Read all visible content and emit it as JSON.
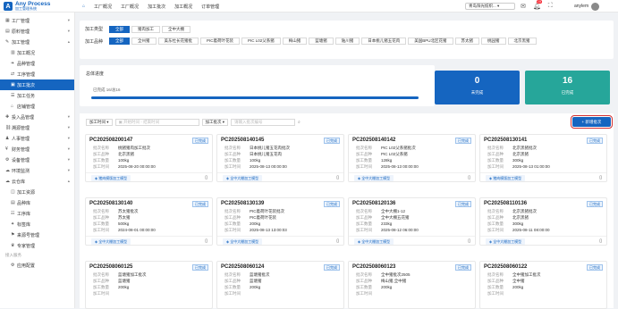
{
  "header": {
    "brand": "Any Process",
    "brand_sub": "加工管理系统",
    "nav": [
      "工厂概况",
      "工厂概况",
      "加工批次",
      "加工概况",
      "订单管理"
    ],
    "factory_select": "青岛阳光纺织...",
    "notif_count": "19",
    "user": "anylem"
  },
  "sidebar": [
    {
      "label": "工厂管理",
      "icon": "factory-icon",
      "kind": "top",
      "caret": "▾"
    },
    {
      "label": "原料管理",
      "icon": "box-icon",
      "kind": "top",
      "caret": "▾"
    },
    {
      "label": "加工管理",
      "icon": "tool-icon",
      "kind": "top",
      "caret": "▴"
    },
    {
      "label": "加工概况",
      "icon": "chart-icon",
      "kind": "sub"
    },
    {
      "label": "品种管理",
      "icon": "leaf-icon",
      "kind": "sub"
    },
    {
      "label": "工序管理",
      "icon": "process-icon",
      "kind": "sub"
    },
    {
      "label": "加工批次",
      "icon": "batch-icon",
      "kind": "sub",
      "active": true
    },
    {
      "label": "加工任务",
      "icon": "task-icon",
      "kind": "sub"
    },
    {
      "label": "店铺管理",
      "icon": "shop-icon",
      "kind": "sub"
    },
    {
      "label": "投入品管理",
      "icon": "input-icon",
      "kind": "top",
      "caret": "▾"
    },
    {
      "label": "溯源管理",
      "icon": "trace-icon",
      "kind": "top",
      "caret": "▾"
    },
    {
      "label": "人事管理",
      "icon": "person-icon",
      "kind": "top",
      "caret": "▾"
    },
    {
      "label": "财务管理",
      "icon": "money-icon",
      "kind": "top",
      "caret": "▾"
    },
    {
      "label": "设备管理",
      "icon": "device-icon",
      "kind": "top",
      "caret": "▾"
    },
    {
      "label": "环境监测",
      "icon": "env-icon",
      "kind": "top",
      "caret": "▾"
    },
    {
      "label": "云仓库",
      "icon": "cloud-icon",
      "kind": "top",
      "caret": "▴"
    },
    {
      "label": "加工资源",
      "icon": "resource-icon",
      "kind": "sub"
    },
    {
      "label": "品种库",
      "icon": "library-icon",
      "kind": "sub"
    },
    {
      "label": "工序库",
      "icon": "procedure-icon",
      "kind": "sub"
    },
    {
      "label": "标签库",
      "icon": "tag-icon",
      "kind": "sub"
    },
    {
      "label": "来源号管理",
      "icon": "source-icon",
      "kind": "sub"
    },
    {
      "label": "专家管理",
      "icon": "expert-icon",
      "kind": "sub"
    },
    {
      "label": "接入服务",
      "icon": "",
      "kind": "grp"
    },
    {
      "label": "应用配置",
      "icon": "config-icon",
      "kind": "sub"
    }
  ],
  "filters": {
    "type_label": "加工类型",
    "types": [
      "全部",
      "猪肉加工",
      "全中大棚"
    ],
    "variety_label": "加工品种",
    "varieties": [
      "全部",
      "全州猪",
      "美东杜长花猪批",
      "PIC着荷叶花装",
      "PIC L02父系猪",
      "梅山猪",
      "蓝塘猪",
      "陆川猪",
      "日本桃儿猪五花肉",
      "美国BPU北区花猪",
      "苏太猪",
      "桃园猪",
      "北京黑猪"
    ]
  },
  "progress": {
    "title": "总体进度",
    "text": "已完成 16/总16",
    "value": 1.0
  },
  "stats": [
    {
      "value": "0",
      "label": "未完成",
      "color": "#1565c0"
    },
    {
      "value": "16",
      "label": "已完成",
      "color": "#26a69a"
    }
  ],
  "toolbar": {
    "time_select": "加工时间",
    "start_ph": "开始时间",
    "sep": "-",
    "end_ph": "结束时间",
    "batch_select": "加工批次",
    "search_ph": "请输入批次编号",
    "add_label": "+ 新增批次"
  },
  "row_labels": [
    "批次名称",
    "加工品种",
    "加工数量",
    "加工时间"
  ],
  "model_btn": "猪肉模版加工模型",
  "batches": [
    {
      "no": "PC202508200147",
      "status": "已完成",
      "name": "桃猪猪肉加工批次",
      "variety": "北京黑猪",
      "qty": "100kg",
      "time": "2025-08-20 00:00:00",
      "btn": "猪肉模版加工模型"
    },
    {
      "no": "PC202508140145",
      "status": "已完成",
      "name": "日本桃儿猪五花肉批次",
      "variety": "日本桃儿猪五花肉",
      "qty": "100kg",
      "time": "2025-08-13 00:00:00",
      "btn": "全中大棚加工模型"
    },
    {
      "no": "PC202508140142",
      "status": "已完成",
      "name": "PIC L02父系猪批次",
      "variety": "PIC L02父系猪",
      "qty": "128kg",
      "time": "2025-08-13 00:00:00",
      "btn": "全中大棚加工模型"
    },
    {
      "no": "PC202508130141",
      "status": "已完成",
      "name": "北京黑猪批次",
      "variety": "北京黑猪",
      "qty": "300kg",
      "time": "2025-08-13 01:00:00",
      "btn": "猪肉模版加工模型"
    },
    {
      "no": "PC202508130140",
      "status": "已完成",
      "name": "苏太猪批次",
      "variety": "苏太猪",
      "qty": "500kg",
      "time": "2024-08-01 00:00:00",
      "btn": "全中大棚加工模型"
    },
    {
      "no": "PC202508130139",
      "status": "已完成",
      "name": "PIC着荷叶花装批次",
      "variety": "PIC着荷叶花装",
      "qty": "200kg",
      "time": "2025-08-13 13:00:03",
      "btn": "全中大棚加工模型"
    },
    {
      "no": "PC202508120136",
      "status": "已完成",
      "name": "全中大棚1-12",
      "variety": "全中大棚五花猪",
      "qty": "233kg",
      "time": "2025-08-12 06:00:00",
      "btn": "全中大棚加工模型"
    },
    {
      "no": "PC202508110136",
      "status": "已完成",
      "name": "北京黑猪批次",
      "variety": "北京黑猪",
      "qty": "300kg",
      "time": "2025-08-11 08:00:00",
      "btn": "全中大棚加工模型"
    },
    {
      "no": "PC202508060125",
      "status": "已完成",
      "name": "蓝塘猪加工批次",
      "variety": "蓝塘猪",
      "qty": "200kg",
      "time": "",
      "btn": ""
    },
    {
      "no": "PC202508060124",
      "status": "已完成",
      "name": "蓝塘猪批次",
      "variety": "蓝塘猪",
      "qty": "200kg",
      "time": "",
      "btn": ""
    },
    {
      "no": "PC202508060123",
      "status": "已完成",
      "name": "全中猪批次2505",
      "variety": "梅山猪,全中猪",
      "qty": "200kg",
      "time": "",
      "btn": ""
    },
    {
      "no": "PC202508060122",
      "status": "已完成",
      "name": "全中猪加工批次",
      "variety": "全中猪",
      "qty": "200kg",
      "time": "",
      "btn": ""
    }
  ]
}
